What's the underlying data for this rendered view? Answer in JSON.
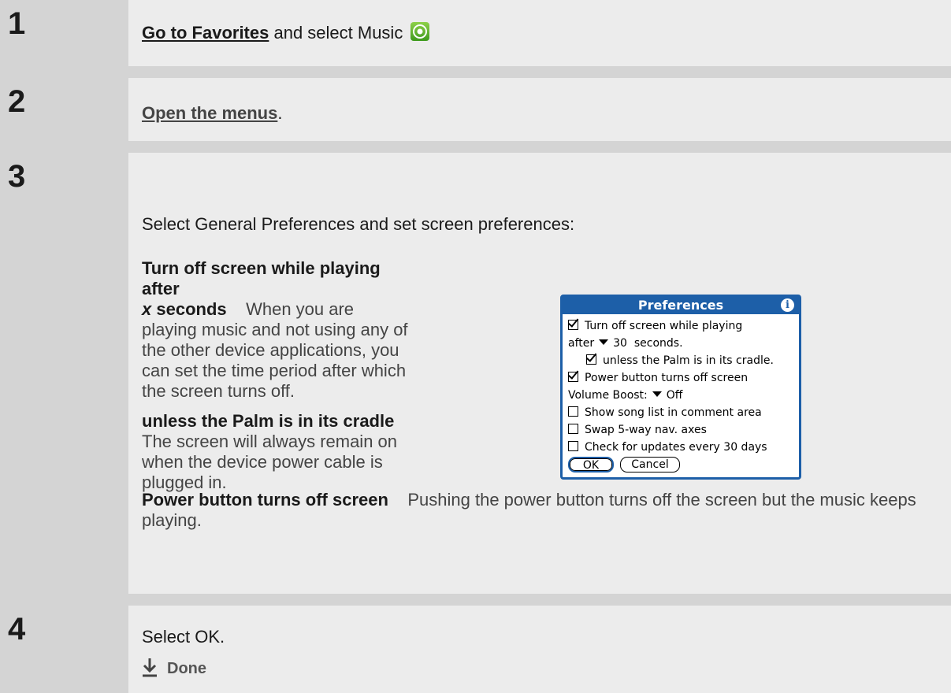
{
  "steps": [
    {
      "number": "1",
      "link": "Go to Favorites",
      "text": " and select Music",
      "icon": "music-icon"
    },
    {
      "number": "2",
      "link": "Open the menus",
      "text": "."
    },
    {
      "number": "3",
      "intro": "Select General Preferences and set screen preferences:",
      "items": [
        {
          "term": "Turn off screen while playing after",
          "term_var": "x",
          "term_tail": " seconds",
          "desc": "When you are playing music and not using any of the other device applications, you can set the time period after which the screen turns off."
        },
        {
          "term": "unless the Palm is in its cradle",
          "desc": "The screen will always remain on when the device power cable is plugged in."
        },
        {
          "term": "Power button turns off screen",
          "desc": "Pushing the power button turns off the screen but the music keeps playing."
        }
      ],
      "dialog": {
        "title": "Preferences",
        "info_icon": "i",
        "rows": {
          "turn_off": "Turn off screen while playing",
          "after_label": "after",
          "after_value": "30",
          "after_unit": "seconds.",
          "unless": "unless the Palm is in its cradle.",
          "power": "Power button turns off screen",
          "volume_label": "Volume Boost:",
          "volume_value": "Off",
          "show_song": "Show song list in comment area",
          "swap": "Swap 5-way nav. axes",
          "check_updates": "Check for updates every 30 days"
        },
        "checked": {
          "turn_off": true,
          "unless": true,
          "power": true,
          "show_song": false,
          "swap": false,
          "check_updates": false
        },
        "ok_label": "OK",
        "cancel_label": "Cancel"
      }
    },
    {
      "number": "4",
      "text": "Select OK.",
      "done_label": "Done"
    }
  ],
  "colors": {
    "number_column": "#d4d4d4",
    "content_background": "#ececec",
    "dialog_accent": "#1d5fa8"
  }
}
